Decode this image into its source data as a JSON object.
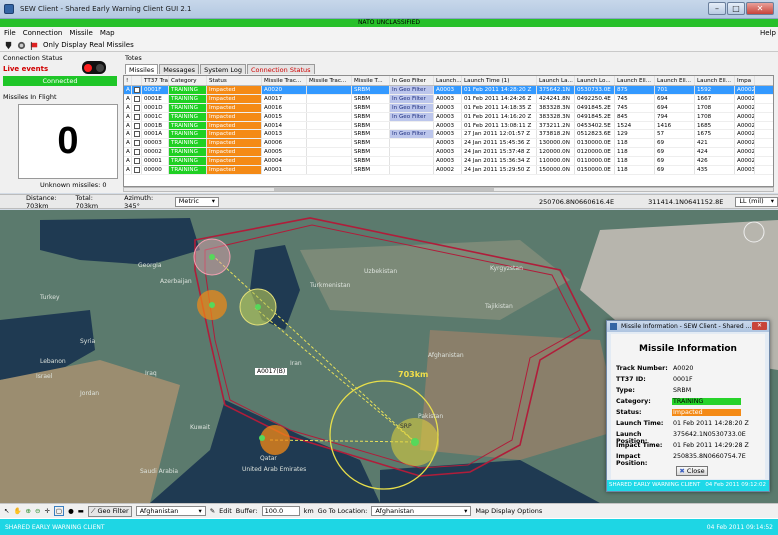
{
  "window": {
    "title": "SEW Client - Shared Early Warning Client GUI 2.1"
  },
  "classification": "NATO UNCLASSIFIED",
  "menu": {
    "file": "File",
    "connection": "Connection",
    "missile": "Missile",
    "map": "Map",
    "help": "Help"
  },
  "toolbar": {
    "only_real_label": "Only Display Real Missiles"
  },
  "left_panel": {
    "section_title": "Connection Status",
    "live_label": "Live events",
    "connected_label": "Connected",
    "missiles_in_flight_label": "Missiles In Flight",
    "missiles_in_flight_count": "0",
    "unknown_missiles_label": "Unknown missiles: 0"
  },
  "totes": {
    "title": "Totes",
    "tabs": [
      "Missiles",
      "Messages",
      "System Log",
      "Connection Status"
    ],
    "columns": [
      "!",
      "TT37 Trac...",
      "Category",
      "Status",
      "Missile Trac...",
      "Missile Trac...",
      "Missile T...",
      "In Geo Filter",
      "Launch...",
      "Launch Time (1)",
      "Launch La...",
      "Launch Lo...",
      "Launch Ell...",
      "Launch Ell...",
      "Launch Ell...",
      "Impa"
    ],
    "rows": [
      [
        "A",
        "✓",
        "0001F",
        "TRAINING",
        "Impacted",
        "A0020",
        "",
        "SRBM",
        "In Geo Filter",
        "A0003",
        "01 Feb 2011 14:28:20 Z",
        "375642.1N",
        "0530733.0E",
        "875",
        "701",
        "1592",
        "A0002"
      ],
      [
        "A",
        "✓",
        "0001E",
        "TRAINING",
        "Impacted",
        "A0017",
        "",
        "SRBM",
        "In Geo Filter",
        "A0003",
        "01 Feb 2011 14:24:26 Z",
        "424241.8N",
        "0492250.4E",
        "745",
        "694",
        "1667",
        "A0002"
      ],
      [
        "A",
        "✓",
        "0001D",
        "TRAINING",
        "Impacted",
        "A0016",
        "",
        "SRBM",
        "In Geo Filter",
        "A0003",
        "01 Feb 2011 14:18:35 Z",
        "383328.3N",
        "0491845.2E",
        "745",
        "694",
        "1708",
        "A0002"
      ],
      [
        "A",
        "✓",
        "0001C",
        "TRAINING",
        "Impacted",
        "A0015",
        "",
        "SRBM",
        "In Geo Filter",
        "A0003",
        "01 Feb 2011 14:16:20 Z",
        "383328.3N",
        "0491845.2E",
        "845",
        "794",
        "1708",
        "A0002"
      ],
      [
        "A",
        "✓",
        "0001B",
        "TRAINING",
        "Impacted",
        "A0014",
        "",
        "SRBM",
        "",
        "A0003",
        "01 Feb 2011 13:08:11 Z",
        "373211.2N",
        "0453402.5E",
        "1524",
        "1416",
        "1685",
        "A0002"
      ],
      [
        "A",
        "✓",
        "0001A",
        "TRAINING",
        "Impacted",
        "A0013",
        "",
        "SRBM",
        "In Geo Filter",
        "A0003",
        "27 Jan 2011 12:01:57 Z",
        "373818.2N",
        "0512823.6E",
        "129",
        "57",
        "1675",
        "A0002"
      ],
      [
        "A",
        "✓",
        "00003",
        "TRAINING",
        "Impacted",
        "A0006",
        "",
        "SRBM",
        "",
        "A0003",
        "24 Jan 2011 15:45:36 Z",
        "130000.0N",
        "0130000.0E",
        "118",
        "69",
        "421",
        "A0002"
      ],
      [
        "A",
        "✓",
        "00002",
        "TRAINING",
        "Impacted",
        "A0005",
        "",
        "SRBM",
        "",
        "A0003",
        "24 Jan 2011 15:37:48 Z",
        "120000.0N",
        "0120000.0E",
        "118",
        "69",
        "424",
        "A0002"
      ],
      [
        "A",
        "✓",
        "00001",
        "TRAINING",
        "Impacted",
        "A0004",
        "",
        "SRBM",
        "",
        "A0003",
        "24 Jan 2011 15:36:34 Z",
        "110000.0N",
        "0110000.0E",
        "118",
        "69",
        "426",
        "A0002"
      ],
      [
        "A",
        "✓",
        "00000",
        "TRAINING",
        "Impacted",
        "A0001",
        "",
        "SRBM",
        "",
        "A0002",
        "24 Jan 2011 15:29:50 Z",
        "150000.0N",
        "0150000.0E",
        "118",
        "69",
        "435",
        "A0003"
      ]
    ]
  },
  "status_bar": {
    "distance": "Distance: 703km",
    "total": "Total: 703km",
    "azimuth": "Azimuth: 345°",
    "units": "Metric",
    "coord1": "250706.8N0660616.4E",
    "coord2": "311414.1N0641152.8E",
    "format": "LL (mil)"
  },
  "map": {
    "labels": [
      "Georgia",
      "Azerbaijan",
      "Turkey",
      "Syria",
      "Lebanon",
      "Israel",
      "Iraq",
      "Jordan",
      "Iran",
      "Turkmenistan",
      "Uzbekistan",
      "Tajikistan",
      "Afghanistan",
      "Pakistan",
      "Kuwait",
      "Saudi Arabia",
      "United Arab Emirates",
      "Qatar",
      "Kyrgyzstan"
    ],
    "range_label": "703km",
    "small_label": "A0017(B)",
    "srp_label": "SRP"
  },
  "popup": {
    "window_title": "Missile Information - SEW Client - Shared ...",
    "heading": "Missile Information",
    "fields": [
      {
        "k": "Track Number:",
        "v": "A0020"
      },
      {
        "k": "TT37 ID:",
        "v": "0001F"
      },
      {
        "k": "Type:",
        "v": "SRBM"
      },
      {
        "k": "Category:",
        "v": "TRAINING"
      },
      {
        "k": "Status:",
        "v": "Impacted"
      },
      {
        "k": "Launch Time:",
        "v": "01 Feb 2011 14:28:20 Z"
      },
      {
        "k": "Launch Position:",
        "v": "375642.1N0530733.0E"
      },
      {
        "k": "Impact Time:",
        "v": "01 Feb 2011 14:29:28 Z"
      },
      {
        "k": "Impact Position:",
        "v": "250835.8N0660754.7E"
      }
    ],
    "close_label": "Close",
    "footer_left": "SHARED EARLY WARNING CLIENT",
    "footer_right": "04 Feb 2011 09:12:02"
  },
  "bottom_toolbar": {
    "geo_filter_label": "Geo Filter",
    "geo_filter_value": "Afghanistan",
    "edit_label": "Edit",
    "buffer_label": "Buffer:",
    "buffer_value": "100.0",
    "km_label": "km",
    "goto_label": "Go To Location:",
    "goto_value": "Afghanistan",
    "options_label": "Map Display Options"
  },
  "footer": {
    "left": "SHARED EARLY WARNING CLIENT",
    "right": "04 Feb 2011 09:14:52"
  },
  "colors": {
    "training": "#1fd023",
    "impacted": "#f48a16",
    "footer": "#1ed6e4",
    "classification": "#27c02a"
  }
}
